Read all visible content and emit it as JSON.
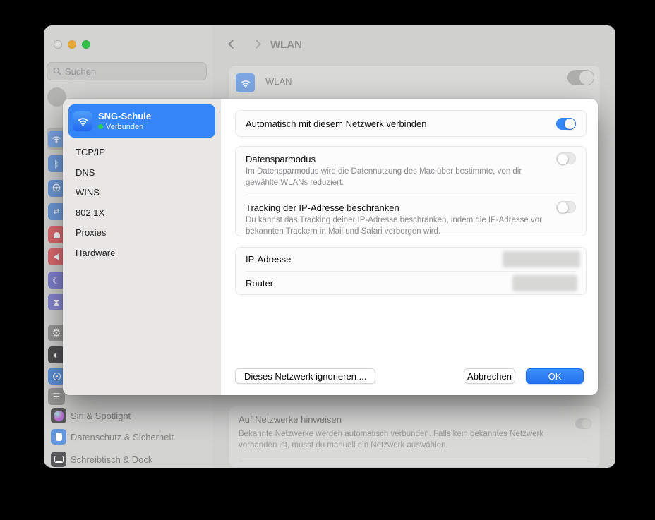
{
  "window": {
    "search_placeholder": "Suchen",
    "nav_title": "WLAN",
    "sidebar_strip_icons": [
      "wifi",
      "bluetooth",
      "network-globe",
      "vpn",
      "notifications-bell",
      "sound-speaker",
      "focus-moon",
      "screen-time-hourglass",
      "general-gear",
      "appearance",
      "accessibility",
      "control-center"
    ],
    "sidebar_items": [
      "Siri & Spotlight",
      "Datenschutz & Sicherheit",
      "Schreibtisch & Dock"
    ],
    "wlan_row": {
      "label": "WLAN",
      "toggle": "on"
    },
    "notify_row": {
      "title": "Auf Netzwerke hinweisen",
      "description": "Bekannte Netzwerke werden automatisch verbunden. Falls kein bekanntes Netzwerk vorhanden ist, musst du manuell ein Netzwerk auswählen.",
      "toggle": "off"
    }
  },
  "dialog": {
    "network": {
      "name": "SNG-Schule",
      "status": "Verbunden"
    },
    "tabs": [
      "TCP/IP",
      "DNS",
      "WINS",
      "802.1X",
      "Proxies",
      "Hardware"
    ],
    "rows": {
      "auto": {
        "title": "Automatisch mit diesem Netzwerk verbinden",
        "toggle": "on"
      },
      "lowdata": {
        "title": "Datensparmodus",
        "description": "Im Datensparmodus wird die Datennutzung des Mac über bestimmte, von dir gewählte WLANs reduziert.",
        "toggle": "off"
      },
      "tracking": {
        "title": "Tracking der IP-Adresse beschränken",
        "description": "Du kannst das Tracking deiner IP-Adresse beschränken, indem die IP-Adresse vor bekannten Trackern in Mail und Safari verborgen wird.",
        "toggle": "off"
      },
      "ip": {
        "label": "IP-Adresse",
        "value_redacted": true
      },
      "router": {
        "label": "Router",
        "value_redacted": true
      }
    },
    "buttons": {
      "ignore": "Dieses Netzwerk ignorieren ...",
      "cancel": "Abbrechen",
      "ok": "OK"
    }
  },
  "colors": {
    "accent_blue": "#3485f7",
    "ok_blue": "#2373f0",
    "connected_green": "#2ed14d"
  }
}
